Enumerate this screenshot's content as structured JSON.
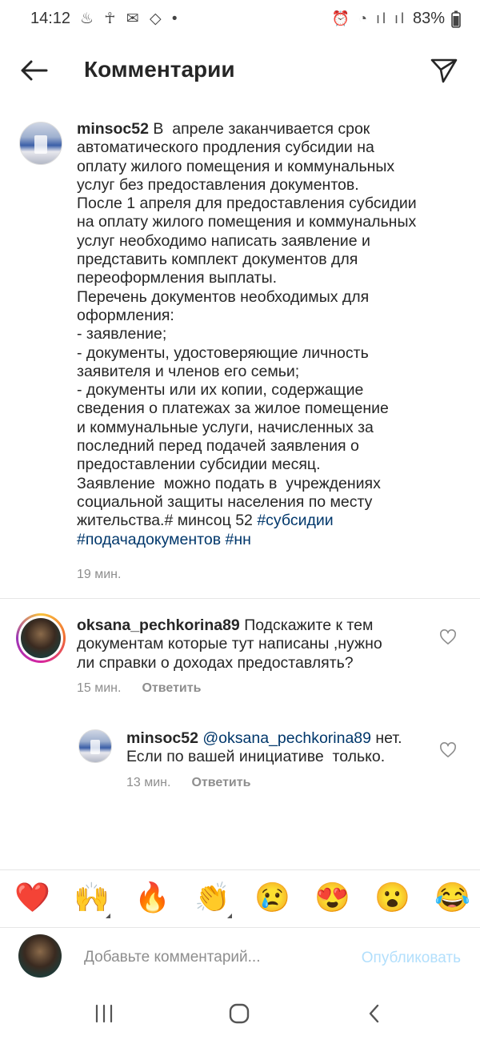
{
  "status_bar": {
    "time": "14:12",
    "notification_icons": [
      "vk-icon",
      "ok-icon",
      "cleaner-icon",
      "gmail-icon",
      "footsteps-icon",
      "dot-icon"
    ],
    "notifications_glyphs": "♨ ☥ ✉ ◇ •",
    "right_icons": [
      "alarm-icon",
      "wifi-icon",
      "signal-icon",
      "signal-icon",
      "battery-icon"
    ],
    "right_glyphs": "⏰ ◔ ıl ıl",
    "battery": "83%"
  },
  "header": {
    "title": "Комментарии",
    "back_icon": "arrow-left-icon",
    "send_icon": "paper-plane-icon"
  },
  "main_comment": {
    "username": "minsoc52",
    "text": " В  апреле заканчивается срок\nавтоматического продления субсидии на\nоплату жилого помещения и коммунальных\nуслуг без предоставления документов.\nПосле 1 апреля для предоставления субсидии\nна оплату жилого помещения и коммунальных\nуслуг необходимо написать заявление и\nпредставить комплект документов для\nпереоформления выплаты.\nПеречень документов необходимых для\nоформления:\n- заявление;\n- документы, удостоверяющие личность\nзаявителя и членов его семьи;\n- документы или их копии, содержащие\nсведения о платежах за жилое помещение\nи коммунальные услуги, начисленных за\nпоследний перед подачей заявления о\nпредоставлении субсидии месяц.\nЗаявление  можно подать в  учреждениях\nсоциальной защиты населения по месту\nжительства.# минсоц 52 ",
    "hashtag1": "#субсидии",
    "hashtag2": "#подачадокументов",
    "hashtag3": "#нн",
    "time": "19 мин."
  },
  "comments": [
    {
      "username": "oksana_pechkorina89",
      "text": " Подскажите к тем\nдокументам которые тут написаны ,нужно\nли справки о доходах предоставлять?",
      "time": "15 мин.",
      "reply_label": "Ответить"
    },
    {
      "username": "minsoc52",
      "mention": "@oksana_pechkorina89",
      "text": " нет.\nЕсли по вашей инициативе  только.",
      "time": "13 мин.",
      "reply_label": "Ответить"
    }
  ],
  "emoji_bar": [
    "❤️",
    "🙌",
    "🔥",
    "👏",
    "😢",
    "😍",
    "😮",
    "😂"
  ],
  "input": {
    "placeholder": "Добавьте комментарий...",
    "publish_label": "Опубликовать"
  },
  "nav_bar": {
    "recents_icon": "recents-icon",
    "home_icon": "home-icon",
    "back_icon": "back-icon"
  },
  "colors": {
    "text": "#262626",
    "secondary": "#8e8e8e",
    "link": "#00376b",
    "publish_disabled": "#b2dffc"
  }
}
